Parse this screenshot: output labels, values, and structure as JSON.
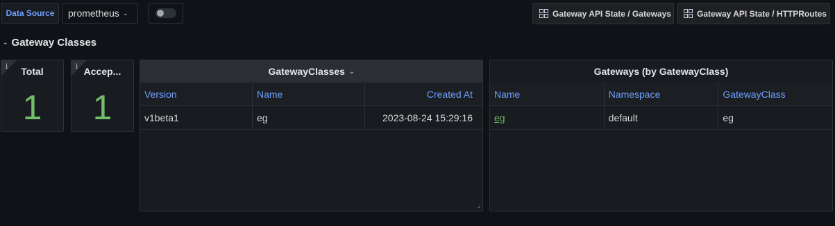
{
  "topbar": {
    "datasource_label": "Data Source",
    "datasource_value": "prometheus",
    "links": [
      {
        "label": "Gateway API State / Gateways",
        "icon": "dashboard-grid-icon"
      },
      {
        "label": "Gateway API State / HTTPRoutes",
        "icon": "dashboard-grid-icon"
      }
    ]
  },
  "row": {
    "title": "Gateway Classes",
    "collapsed": false
  },
  "stats": [
    {
      "title": "Total",
      "value": "1",
      "color": "#73bf69"
    },
    {
      "title": "Accep...",
      "value": "1",
      "color": "#73bf69"
    }
  ],
  "gatewayclasses_table": {
    "title": "GatewayClasses",
    "columns": [
      "Version",
      "Name",
      "Created At"
    ],
    "rows": [
      [
        "v1beta1",
        "eg",
        "2023-08-24 15:29:16"
      ]
    ]
  },
  "gateways_table": {
    "title": "Gateways (by GatewayClass)",
    "columns": [
      "Name",
      "Namespace",
      "GatewayClass"
    ],
    "rows": [
      [
        "eg",
        "default",
        "eg"
      ]
    ]
  },
  "colors": {
    "background": "#111217",
    "panel": "#181b1f",
    "header_link": "#6e9fff",
    "stat_green": "#73bf69"
  }
}
